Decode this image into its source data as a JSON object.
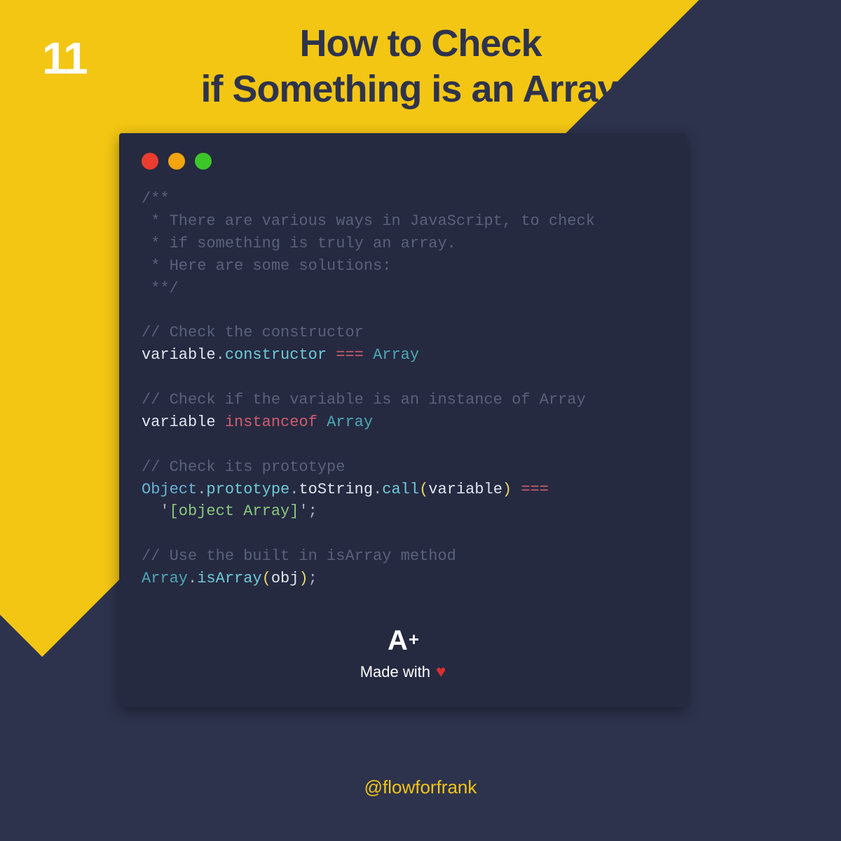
{
  "page_number": "11",
  "title_line1": "How to Check",
  "title_line2": "if Something is an Array?",
  "code": {
    "block_comment_l1": "/**",
    "block_comment_l2": " * There are various ways in JavaScript, to check",
    "block_comment_l3": " * if something is truly an array.",
    "block_comment_l4": " * Here are some solutions:",
    "block_comment_l5": " **/",
    "c1": "// Check the constructor",
    "l1_variable": "variable",
    "l1_dot": ".",
    "l1_constructor": "constructor",
    "l1_op": " === ",
    "l1_array": "Array",
    "c2": "// Check if the variable is an instance of Array",
    "l2_variable": "variable",
    "l2_instanceof": " instanceof ",
    "l2_array": "Array",
    "c3": "// Check its prototype",
    "l3_object": "Object",
    "l3_d1": ".",
    "l3_prototype": "prototype",
    "l3_d2": ".",
    "l3_tostring": "toString",
    "l3_d3": ".",
    "l3_call": "call",
    "l3_po": "(",
    "l3_arg": "variable",
    "l3_pc": ")",
    "l3_op": " ===",
    "l3b_indent": "  ",
    "l3b_q1": "'",
    "l3b_str": "[object Array]",
    "l3b_q2": "'",
    "l3b_semi": ";",
    "c4": "// Use the built in isArray method",
    "l4_array": "Array",
    "l4_d": ".",
    "l4_isarray": "isArray",
    "l4_po": "(",
    "l4_arg": "obj",
    "l4_pc": ")",
    "l4_semi": ";"
  },
  "logo_a": "A",
  "logo_plus": "+",
  "made_with": "Made with",
  "handle": "@flowforfrank"
}
